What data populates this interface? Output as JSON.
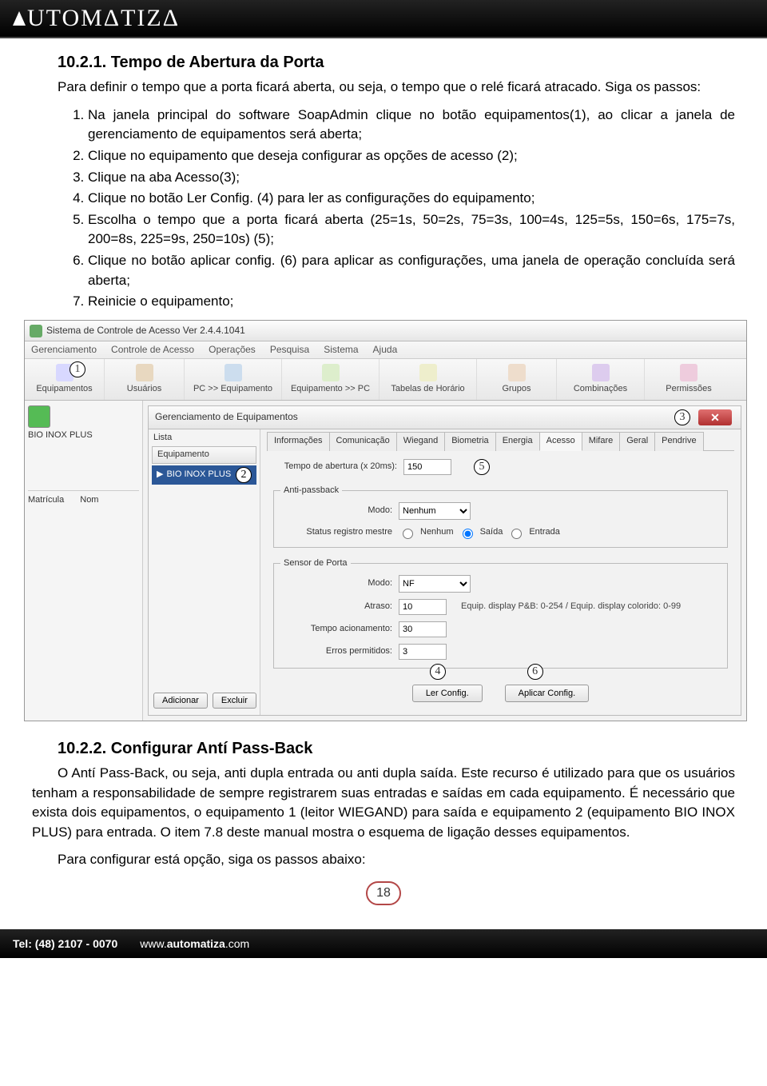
{
  "header": {
    "logo_text": "UTOMΔTIZΔ"
  },
  "section1": {
    "number": "10.2.1.",
    "title": "Tempo de Abertura da Porta",
    "intro": "Para definir o tempo que a porta ficará aberta, ou seja, o tempo que o relé ficará atracado. Siga os passos:",
    "steps": [
      "Na janela principal do software SoapAdmin clique no botão equipamentos(1), ao clicar a janela de gerenciamento de equipamentos será aberta;",
      "Clique no equipamento que deseja configurar as opções de acesso (2);",
      "Clique na aba Acesso(3);",
      "Clique no botão Ler Config. (4) para ler as configurações do equipamento;",
      "Escolha o tempo que a porta ficará aberta (25=1s, 50=2s, 75=3s, 100=4s, 125=5s, 150=6s, 175=7s, 200=8s, 225=9s, 250=10s) (5);",
      "Clique no botão aplicar config. (6) para aplicar as configurações, uma janela de operação concluída será aberta;",
      "Reinicie o equipamento;"
    ]
  },
  "app": {
    "window_title": "Sistema de Controle de Acesso  Ver 2.4.4.1041",
    "menu": [
      "Gerenciamento",
      "Controle de Acesso",
      "Operações",
      "Pesquisa",
      "Sistema",
      "Ajuda"
    ],
    "toolbar": [
      {
        "label": "Equipamentos"
      },
      {
        "label": "Usuários"
      },
      {
        "label": "PC >> Equipamento"
      },
      {
        "label": "Equipamento >> PC"
      },
      {
        "label": "Tabelas de Horário"
      },
      {
        "label": "Grupos"
      },
      {
        "label": "Combinações"
      },
      {
        "label": "Permissões"
      }
    ],
    "sidebar_device": "BIO INOX PLUS",
    "sidebar_cols": {
      "c1": "Matrícula",
      "c2": "Nom"
    },
    "panel_title": "Gerenciamento de Equipamentos",
    "list_label": "Lista",
    "list_header": "Equipamento",
    "list_selected": "BIO INOX PLUS",
    "list_btn_add": "Adicionar",
    "list_btn_del": "Excluir",
    "tabs": [
      "Informações",
      "Comunicação",
      "Wiegand",
      "Biometria",
      "Energia",
      "Acesso",
      "Mifare",
      "Geral",
      "Pendrive"
    ],
    "form": {
      "tempo_abertura_label": "Tempo de abertura (x 20ms):",
      "tempo_abertura_value": "150",
      "anti_passback_group": "Anti-passback",
      "modo_label": "Modo:",
      "modo_value": "Nenhum",
      "status_label": "Status registro mestre",
      "status_options": {
        "nenhum": "Nenhum",
        "saida": "Saída",
        "entrada": "Entrada"
      },
      "sensor_group": "Sensor de Porta",
      "sensor_modo_value": "NF",
      "atraso_label": "Atraso:",
      "atraso_value": "10",
      "atraso_hint": "Equip. display P&B: 0-254 / Equip. display colorido: 0-99",
      "tempo_acion_label": "Tempo acionamento:",
      "tempo_acion_value": "30",
      "erros_label": "Erros permitidos:",
      "erros_value": "3",
      "btn_read": "Ler Config.",
      "btn_apply": "Aplicar Config."
    },
    "callouts": {
      "c1": "1",
      "c2": "2",
      "c3": "3",
      "c4": "4",
      "c5": "5",
      "c6": "6"
    }
  },
  "section2": {
    "number": "10.2.2.",
    "title": "Configurar Antí Pass-Back",
    "p1": "O Antí Pass-Back, ou seja, anti dupla entrada ou anti dupla saída. Este recurso é utilizado para que os usuários tenham a responsabilidade de sempre registrarem suas entradas e saídas em cada equipamento. É necessário que exista dois equipamentos, o equipamento 1 (leitor WIEGAND) para saída e equipamento 2 (equipamento BIO INOX PLUS) para entrada. O item 7.8 deste manual mostra o esquema de ligação desses equipamentos.",
    "p2": "Para configurar está opção, siga os passos abaixo:"
  },
  "footer": {
    "tel_label": "Tel: (48) 2107 - 0070",
    "site_prefix": "www.",
    "site_bold": "automatiza",
    "site_suffix": ".com"
  },
  "page_number": "18"
}
